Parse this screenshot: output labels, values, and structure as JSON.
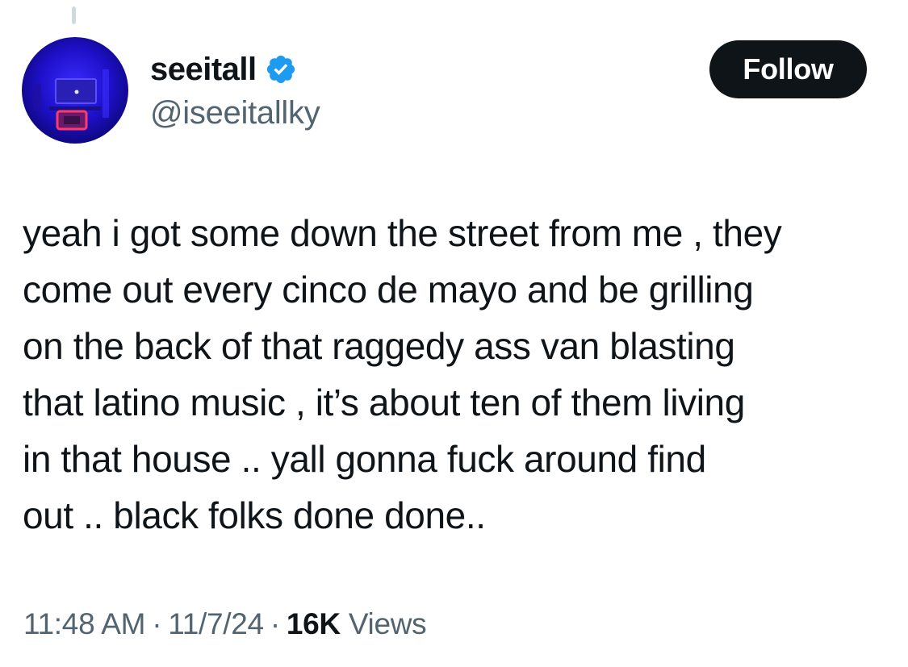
{
  "tweet": {
    "author": {
      "display_name": "seeitall",
      "handle": "@iseeitallky",
      "verified": true,
      "verified_icon": "verified-badge-icon",
      "avatar_icon": "avatar-image"
    },
    "follow_label": "Follow",
    "text_lines": [
      "yeah i got some down the street from me , they",
      "come out every cinco de mayo and be grilling",
      "on the back of that raggedy ass van blasting",
      "that latino music , it’s about ten of them living",
      "in that house .. yall gonna fuck around find",
      "out .. black folks done done.."
    ],
    "time": "11:48 AM",
    "date": "11/7/24",
    "views_count": "16K",
    "views_label": "Views",
    "separator": "·"
  },
  "colors": {
    "text_primary": "#0f1419",
    "text_secondary": "#536471",
    "verified_blue": "#1d9bf0",
    "button_bg": "#0f1419",
    "thread_line": "#cfd9de"
  }
}
